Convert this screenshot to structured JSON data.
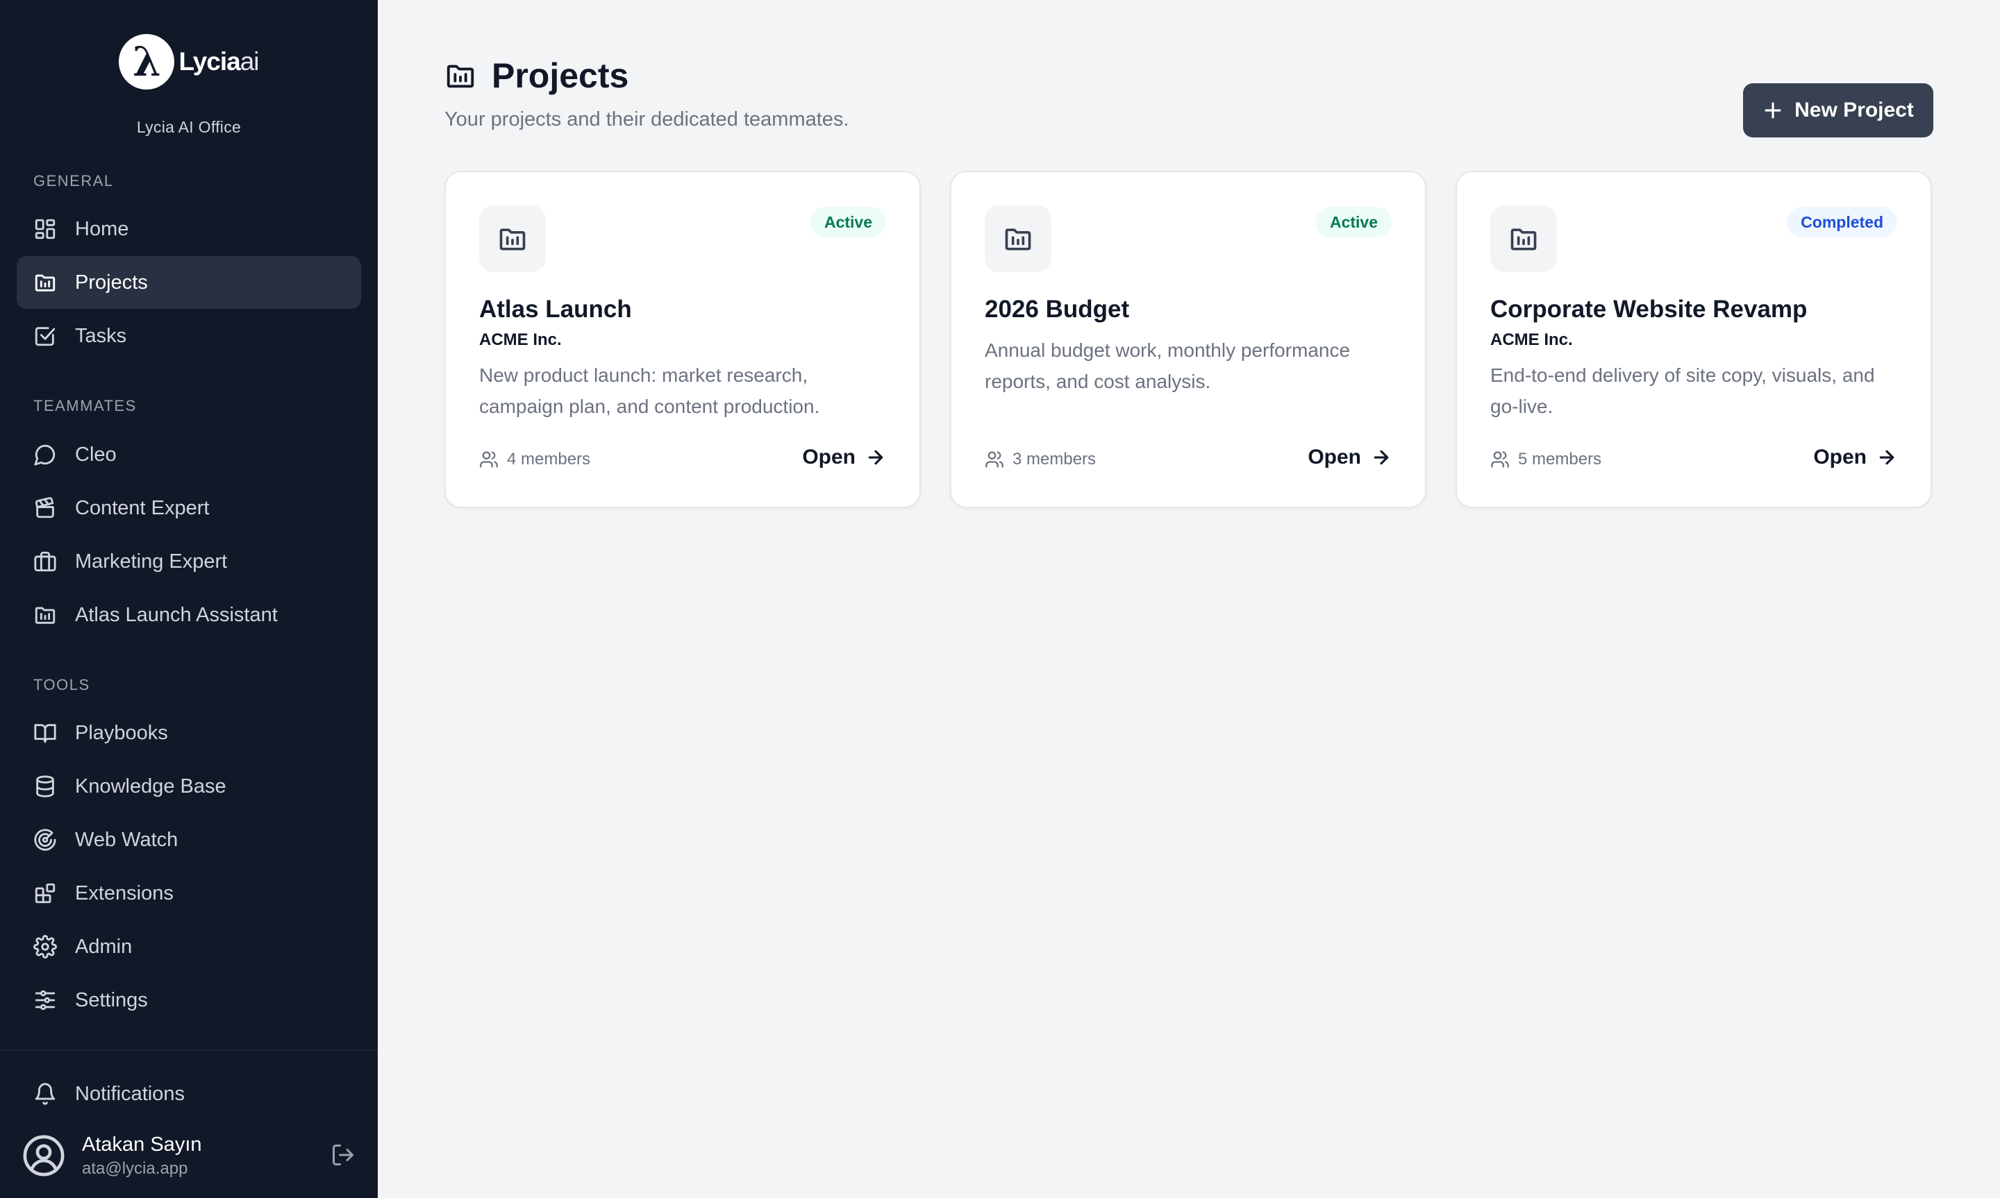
{
  "app": {
    "logo_main": "Lycia",
    "logo_suffix": "ai",
    "org_name": "Lycia AI Office"
  },
  "sidebar": {
    "sections": {
      "general": "GENERAL",
      "teammates": "TEAMMATES",
      "tools": "TOOLS"
    },
    "general": [
      {
        "label": "Home",
        "icon": "grid-icon"
      },
      {
        "label": "Projects",
        "icon": "folder-chart-icon",
        "active": true
      },
      {
        "label": "Tasks",
        "icon": "checkbox-icon"
      }
    ],
    "teammates": [
      {
        "label": "Cleo",
        "icon": "chat-bubble-icon"
      },
      {
        "label": "Content Expert",
        "icon": "clapperboard-icon"
      },
      {
        "label": "Marketing Expert",
        "icon": "briefcase-icon"
      },
      {
        "label": "Atlas Launch Assistant",
        "icon": "folder-chart-icon"
      }
    ],
    "tools": [
      {
        "label": "Playbooks",
        "icon": "book-open-icon"
      },
      {
        "label": "Knowledge Base",
        "icon": "database-icon"
      },
      {
        "label": "Web Watch",
        "icon": "radar-icon"
      },
      {
        "label": "Extensions",
        "icon": "blocks-icon"
      },
      {
        "label": "Admin",
        "icon": "gear-icon"
      },
      {
        "label": "Settings",
        "icon": "sliders-icon"
      }
    ],
    "notifications": {
      "label": "Notifications",
      "icon": "bell-icon"
    },
    "user": {
      "name": "Atakan Sayın",
      "email": "ata@lycia.app"
    }
  },
  "main": {
    "title": "Projects",
    "subtitle": "Your projects and their dedicated teammates.",
    "new_project_label": "New Project",
    "projects": [
      {
        "title": "Atlas Launch",
        "client": "ACME Inc.",
        "status": "Active",
        "description": "New product launch: market research, campaign plan, and content production.",
        "members": "4 members",
        "open_label": "Open"
      },
      {
        "title": "2026 Budget",
        "client": "",
        "status": "Active",
        "description": "Annual budget work, monthly performance reports, and cost analysis.",
        "members": "3 members",
        "open_label": "Open"
      },
      {
        "title": "Corporate Website Revamp",
        "client": "ACME Inc.",
        "status": "Completed",
        "description": "End-to-end delivery of site copy, visuals, and go-live.",
        "members": "5 members",
        "open_label": "Open"
      }
    ]
  },
  "colors": {
    "sidebar_bg": "#111827",
    "active_item_bg": "#283041",
    "primary_button": "#374151",
    "badge_active_bg": "#ecfdf5",
    "badge_active_text": "#047857",
    "badge_completed_bg": "#eff6ff",
    "badge_completed_text": "#1d4ed8"
  }
}
